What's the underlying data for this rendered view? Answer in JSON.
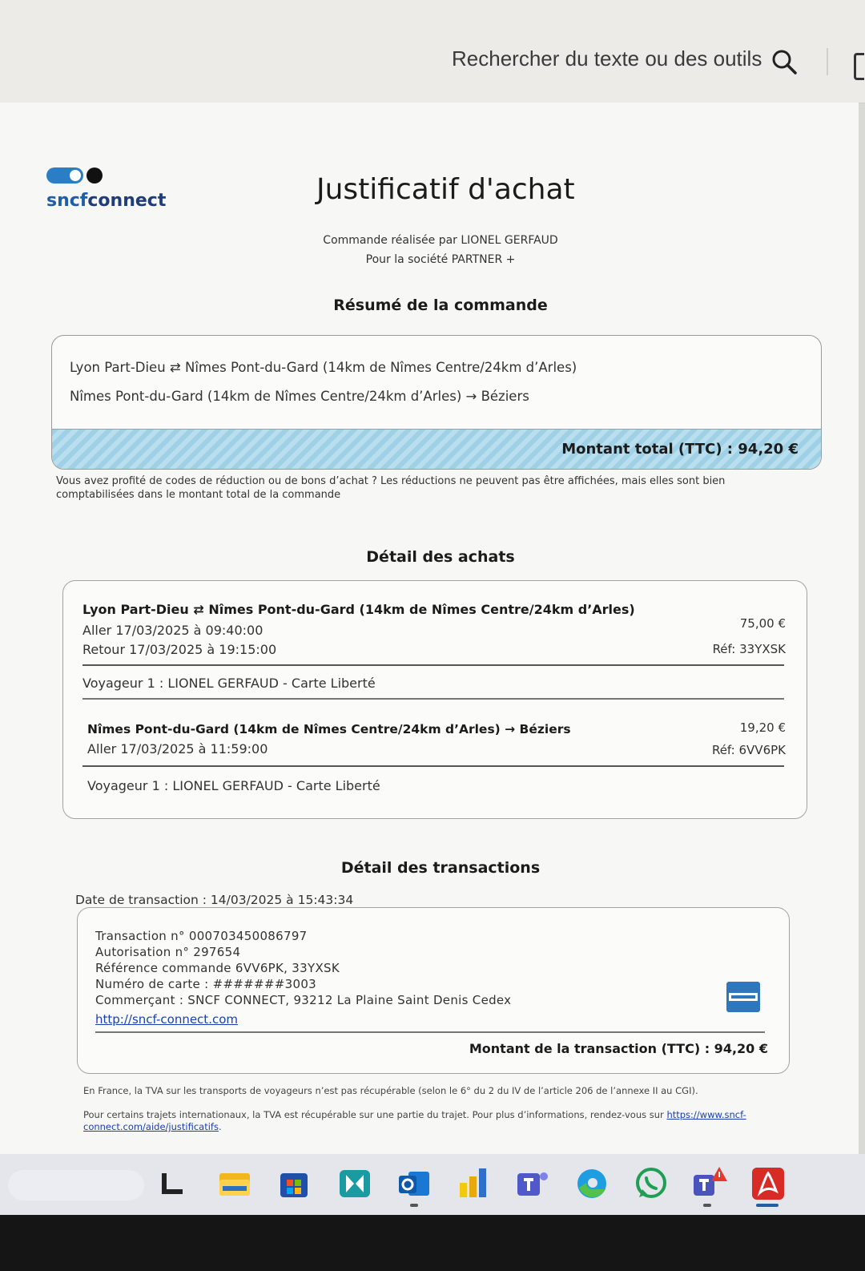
{
  "toolbar": {
    "search_text": "Rechercher du texte ou des outils",
    "search_icon": "search-icon"
  },
  "header": {
    "logo_sncf": "sncf",
    "logo_connect": "connect",
    "title": "Justificatif d'achat",
    "ordered_by": "Commande réalisée par LIONEL GERFAUD",
    "company": "Pour la société PARTNER +"
  },
  "summary": {
    "section_title": "Résumé de la commande",
    "routes": [
      "Lyon Part-Dieu ⇄ Nîmes Pont-du-Gard (14km de Nîmes Centre/24km d’Arles)",
      "Nîmes Pont-du-Gard (14km de Nîmes Centre/24km d’Arles) → Béziers"
    ],
    "total": "Montant total (TTC) : 94,20 €",
    "discount_note": "Vous avez profité de codes de réduction ou de bons d’achat ? Les réductions ne peuvent pas être affichées, mais elles sont bien comptabilisées dans le montant total de la commande"
  },
  "purchases": {
    "section_title": "Détail des achats",
    "items": [
      {
        "route": "Lyon Part-Dieu ⇄ Nîmes Pont-du-Gard (14km de Nîmes Centre/24km d’Arles)",
        "outbound": "Aller 17/03/2025 à 09:40:00",
        "return": "Retour 17/03/2025 à 19:15:00",
        "price": "75,00 €",
        "ref": "Réf: 33YXSK",
        "traveler": "Voyageur 1 : LIONEL GERFAUD - Carte Liberté"
      },
      {
        "route": "Nîmes Pont-du-Gard (14km de Nîmes Centre/24km d’Arles) → Béziers",
        "outbound": "Aller 17/03/2025 à 11:59:00",
        "price": "19,20 €",
        "ref": "Réf: 6VV6PK",
        "traveler": "Voyageur 1 : LIONEL GERFAUD - Carte Liberté"
      }
    ]
  },
  "transactions": {
    "section_title": "Détail des transactions",
    "date": "Date de transaction : 14/03/2025 à 15:43:34",
    "number": "Transaction n° 000703450086797",
    "authorization": "Autorisation n° 297654",
    "order_ref": "Référence commande 6VV6PK, 33YXSK",
    "card": "Numéro de carte : #######3003",
    "merchant": "Commerçant : SNCF CONNECT, 93212 La Plaine Saint Denis Cedex",
    "link": "http://sncf-connect.com",
    "total": "Montant de la transaction (TTC) : 94,20 €",
    "card_brand_icon": "amex-card-icon"
  },
  "footer": {
    "vat_note": "En France, la TVA sur les transports de voyageurs n’est pas récupérable (selon le 6° du 2 du IV de l’article 206 de l’annexe II au CGI).",
    "vat_note2_text": "Pour certains trajets internationaux, la TVA est récupérable sur une partie du trajet. Pour plus d’informations, rendez-vous sur ",
    "vat_note2_link": "https://www.sncf-connect.com/aide/justificatifs",
    "vat_note2_end": "."
  },
  "taskbar": {
    "apps": [
      "task-view-icon",
      "file-explorer-icon",
      "microsoft-store-icon",
      "dynamics-icon",
      "outlook-icon",
      "power-bi-icon",
      "teams-icon",
      "edge-icon",
      "whatsapp-icon",
      "teams-alert-icon",
      "acrobat-icon"
    ]
  },
  "colors": {
    "accent_blue": "#1f5fa8",
    "total_bar": "#9ed0e6",
    "link": "#1a3fb5"
  }
}
